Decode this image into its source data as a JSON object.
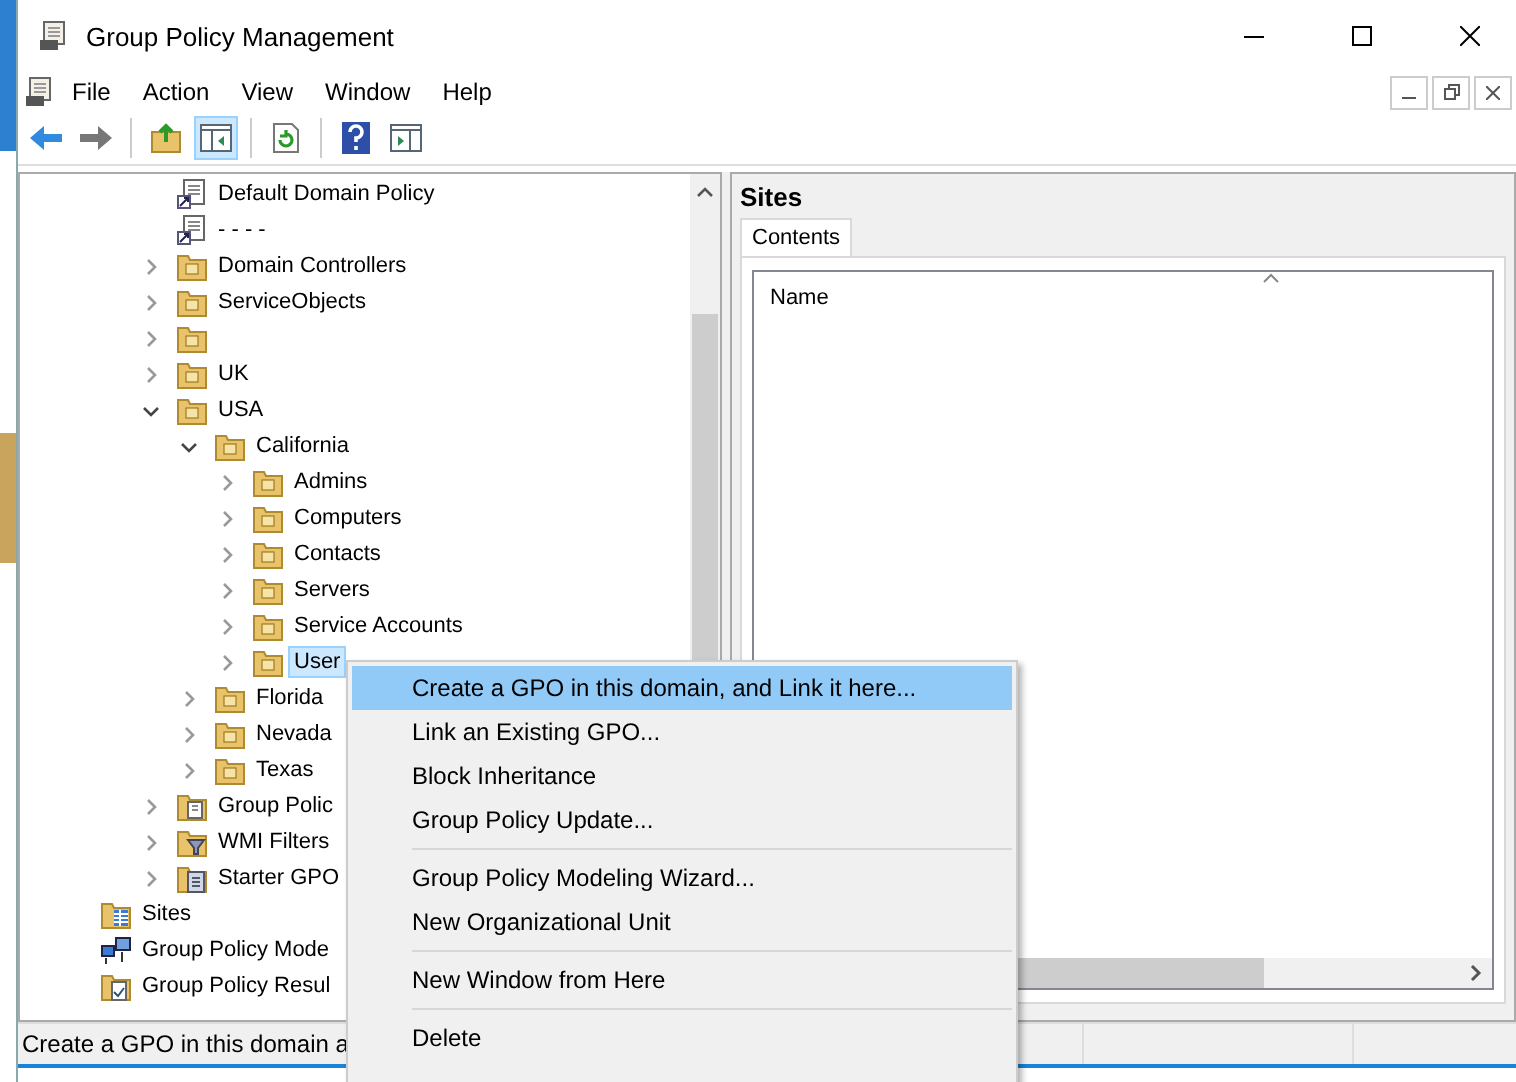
{
  "window": {
    "title": "Group Policy Management"
  },
  "menu_bar": [
    "File",
    "Action",
    "View",
    "Window",
    "Help"
  ],
  "toolbar": [
    {
      "kind": "back",
      "selected": false
    },
    {
      "kind": "forward",
      "selected": false
    },
    {
      "kind": "sep"
    },
    {
      "kind": "up",
      "selected": false
    },
    {
      "kind": "tree",
      "selected": true
    },
    {
      "kind": "sep"
    },
    {
      "kind": "refresh",
      "selected": false
    },
    {
      "kind": "sep"
    },
    {
      "kind": "help",
      "selected": false
    },
    {
      "kind": "panel",
      "selected": false
    }
  ],
  "tree": {
    "items": [
      {
        "children": [
          {
            "children": [
              {
                "label": "Default Domain Policy",
                "kind": "link",
                "selected": false
              },
              {
                "label": "- - - -",
                "kind": "link",
                "selected": false
              },
              {
                "label": "Domain Controllers",
                "kind": "ou",
                "expanded": false,
                "selected": false
              },
              {
                "label": "ServiceObjects",
                "kind": "ou",
                "expanded": false,
                "selected": false
              },
              {
                "kind": "ou",
                "expanded": false,
                "selected": false
              },
              {
                "label": "UK",
                "kind": "ou",
                "expanded": false,
                "selected": false
              },
              {
                "label": "USA",
                "kind": "ou",
                "expanded": true,
                "selected": false,
                "children": [
                  {
                    "label": "California",
                    "kind": "ou",
                    "expanded": true,
                    "selected": false,
                    "children": [
                      {
                        "label": "Admins",
                        "kind": "ou",
                        "expanded": false,
                        "selected": false
                      },
                      {
                        "label": "Computers",
                        "kind": "ou",
                        "expanded": false,
                        "selected": false
                      },
                      {
                        "label": "Contacts",
                        "kind": "ou",
                        "expanded": false,
                        "selected": false
                      },
                      {
                        "label": "Servers",
                        "kind": "ou",
                        "expanded": false,
                        "selected": false
                      },
                      {
                        "label": "Service Accounts",
                        "kind": "ou",
                        "expanded": false,
                        "selected": false
                      },
                      {
                        "label": "User",
                        "kind": "ou",
                        "expanded": false,
                        "selected": true
                      }
                    ]
                  },
                  {
                    "label": "Florida",
                    "kind": "ou",
                    "expanded": false,
                    "selected": false
                  },
                  {
                    "label": "Nevada",
                    "kind": "ou",
                    "expanded": false,
                    "selected": false
                  },
                  {
                    "label": "Texas",
                    "kind": "ou",
                    "expanded": false,
                    "selected": false
                  }
                ]
              },
              {
                "label": "Group Polic",
                "kind": "gpo-folder",
                "expanded": false,
                "selected": false
              },
              {
                "label": "WMI Filters",
                "kind": "wmi",
                "expanded": false,
                "selected": false
              },
              {
                "label": "Starter GPO",
                "kind": "starter",
                "expanded": false,
                "selected": false
              }
            ]
          }
        ]
      },
      {
        "label": "Sites",
        "kind": "sites",
        "selected": false
      },
      {
        "label": "Group Policy Mode",
        "kind": "modeling",
        "selected": false
      },
      {
        "label": "Group Policy Resul",
        "kind": "results",
        "selected": false
      }
    ]
  },
  "details": {
    "title": "Sites",
    "tabs": [
      {
        "label": "Contents",
        "selected": true
      }
    ],
    "columns": [
      "Name"
    ]
  },
  "context_menu": {
    "groups": [
      [
        {
          "label": "Create a GPO in this domain, and Link it here...",
          "selected": true
        },
        {
          "label": "Link an Existing GPO...",
          "selected": false
        },
        {
          "label": "Block Inheritance",
          "selected": false
        },
        {
          "label": "Group Policy Update...",
          "selected": false
        }
      ],
      [
        {
          "label": "Group Policy Modeling Wizard...",
          "selected": false
        },
        {
          "label": "New Organizational Unit",
          "selected": false
        }
      ],
      [
        {
          "label": "New Window from Here",
          "selected": false
        }
      ],
      [
        {
          "label": "Delete",
          "selected": false
        }
      ]
    ]
  },
  "status_bar": "Create a GPO in this domain a"
}
